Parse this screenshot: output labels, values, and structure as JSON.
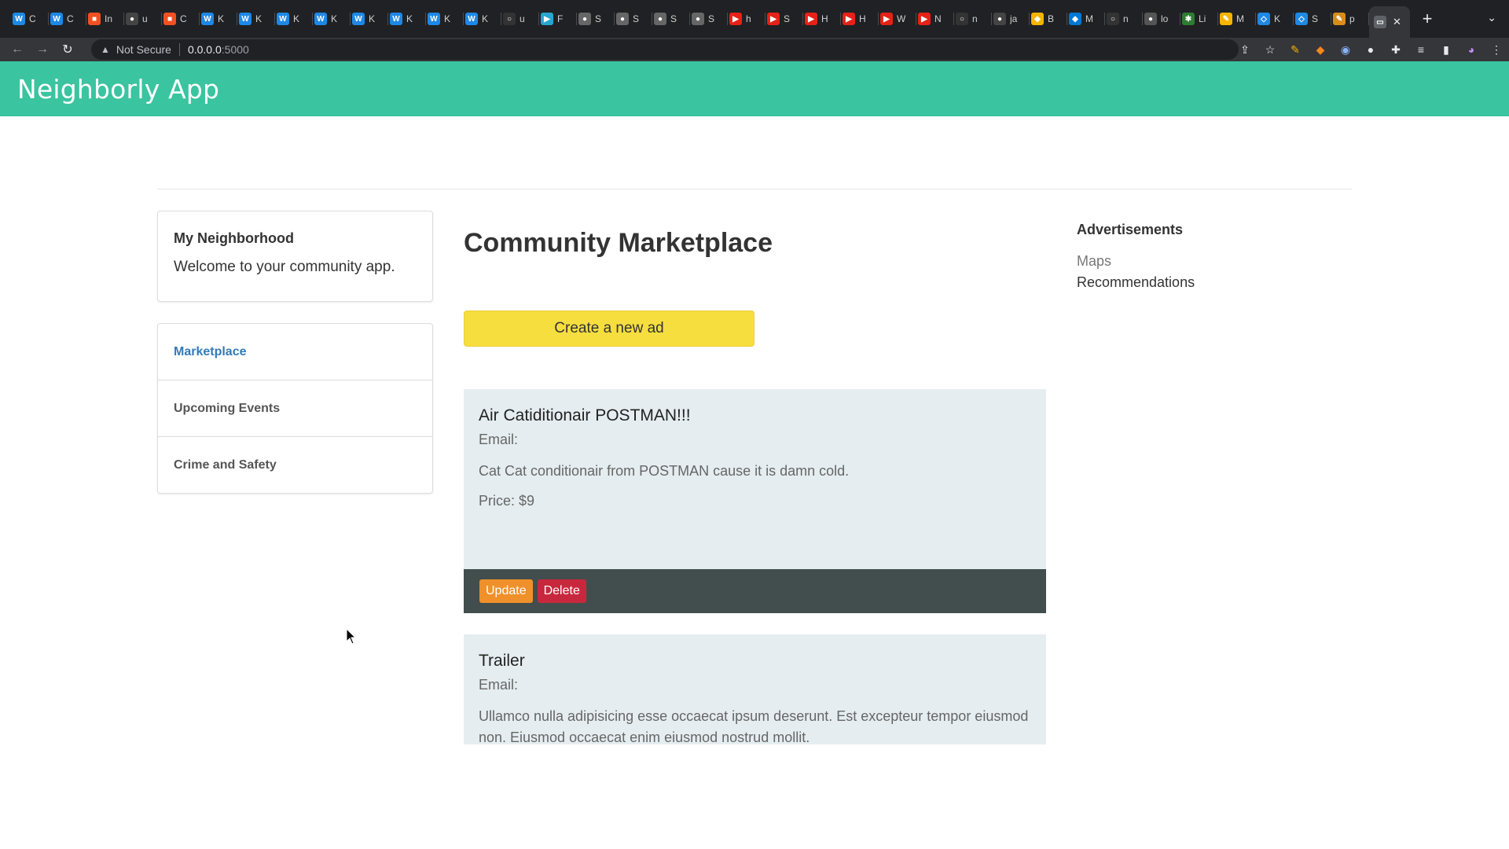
{
  "browser": {
    "tabs": [
      {
        "label": "C",
        "color": "#1e88e5",
        "glyph": "W"
      },
      {
        "label": "C",
        "color": "#1e88e5",
        "glyph": "W"
      },
      {
        "label": "In",
        "color": "#f25022",
        "glyph": "■"
      },
      {
        "label": "u",
        "color": "#444",
        "glyph": "●"
      },
      {
        "label": "C",
        "color": "#f25022",
        "glyph": "■"
      },
      {
        "label": "K",
        "color": "#1e88e5",
        "glyph": "W"
      },
      {
        "label": "K",
        "color": "#1e88e5",
        "glyph": "W"
      },
      {
        "label": "K",
        "color": "#1e88e5",
        "glyph": "W"
      },
      {
        "label": "K",
        "color": "#1e88e5",
        "glyph": "W"
      },
      {
        "label": "K",
        "color": "#1e88e5",
        "glyph": "W"
      },
      {
        "label": "K",
        "color": "#1e88e5",
        "glyph": "W"
      },
      {
        "label": "K",
        "color": "#1e88e5",
        "glyph": "W"
      },
      {
        "label": "K",
        "color": "#1e88e5",
        "glyph": "W"
      },
      {
        "label": "u",
        "color": "#333",
        "glyph": "○"
      },
      {
        "label": "F",
        "color": "#26a6d1",
        "glyph": "▶"
      },
      {
        "label": "S",
        "color": "#666",
        "glyph": "●"
      },
      {
        "label": "S",
        "color": "#666",
        "glyph": "●"
      },
      {
        "label": "S",
        "color": "#666",
        "glyph": "●"
      },
      {
        "label": "S",
        "color": "#666",
        "glyph": "●"
      },
      {
        "label": "h",
        "color": "#e62117",
        "glyph": "▶"
      },
      {
        "label": "S",
        "color": "#e62117",
        "glyph": "▶"
      },
      {
        "label": "H",
        "color": "#e62117",
        "glyph": "▶"
      },
      {
        "label": "H",
        "color": "#e62117",
        "glyph": "▶"
      },
      {
        "label": "W",
        "color": "#e62117",
        "glyph": "▶"
      },
      {
        "label": "N",
        "color": "#e62117",
        "glyph": "▶"
      },
      {
        "label": "n",
        "color": "#333",
        "glyph": "○"
      },
      {
        "label": "ja",
        "color": "#444",
        "glyph": "●"
      },
      {
        "label": "B",
        "color": "#f4b400",
        "glyph": "◆"
      },
      {
        "label": "M",
        "color": "#0078d4",
        "glyph": "◆"
      },
      {
        "label": "n",
        "color": "#333",
        "glyph": "○"
      },
      {
        "label": "lo",
        "color": "#555",
        "glyph": "●"
      },
      {
        "label": "Li",
        "color": "#2e7d32",
        "glyph": "✱"
      },
      {
        "label": "M",
        "color": "#f4b400",
        "glyph": "✎"
      },
      {
        "label": "K",
        "color": "#1e88e5",
        "glyph": "◇"
      },
      {
        "label": "S",
        "color": "#1e88e5",
        "glyph": "◇"
      },
      {
        "label": "p",
        "color": "#d98c1a",
        "glyph": "✎"
      }
    ],
    "address": {
      "security_label": "Not Secure",
      "host": "0.0.0.0",
      "port": ":5000"
    }
  },
  "app": {
    "brand": "Neighborly App"
  },
  "sidebar": {
    "hood_title": "My Neighborhood",
    "hood_text": "Welcome to your community app.",
    "nav": [
      {
        "label": "Marketplace",
        "active": true
      },
      {
        "label": "Upcoming Events",
        "active": false
      },
      {
        "label": "Crime and Safety",
        "active": false
      }
    ]
  },
  "main": {
    "title": "Community Marketplace",
    "create_label": "Create a new ad",
    "listings": [
      {
        "title": "Air Catiditionair POSTMAN!!!",
        "email": "Email:",
        "description": "Cat Cat conditionair from POSTMAN cause it is damn cold.",
        "price": "Price: $9",
        "update_label": "Update",
        "delete_label": "Delete"
      },
      {
        "title": "Trailer",
        "email": "Email:",
        "description": "Ullamco nulla adipisicing esse occaecat ipsum deserunt. Est excepteur tempor eiusmod non. Eiusmod occaecat enim eiusmod nostrud mollit."
      }
    ]
  },
  "ads": {
    "title": "Advertisements",
    "links": [
      "Maps",
      "Recommendations"
    ]
  }
}
